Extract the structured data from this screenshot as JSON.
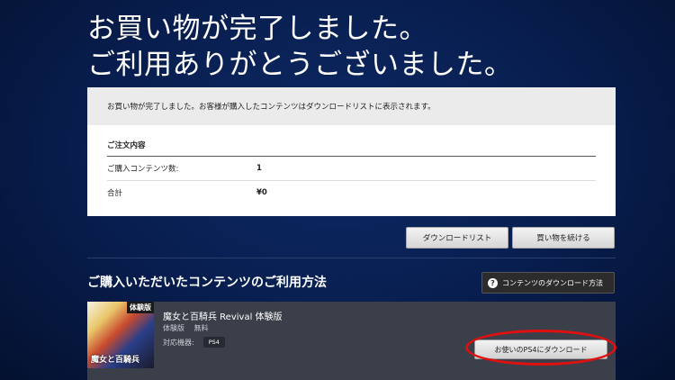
{
  "headline": {
    "line1": "お買い物が完了しました。",
    "line2": "ご利用ありがとうございました。"
  },
  "panel": {
    "message": "お買い物が完了しました。お客様が購入したコンテンツはダウンロードリストに表示されます。",
    "order_title": "ご注文内容",
    "rows": [
      {
        "label": "ご購入コンテンツ数:",
        "value": "1"
      },
      {
        "label": "合計",
        "value": "¥0"
      }
    ]
  },
  "buttons": {
    "download_list": "ダウンロードリスト",
    "continue_shopping": "買い物を続ける",
    "how_to_download": "コンテンツのダウンロード方法"
  },
  "section": {
    "title": "ご購入いただいたコンテンツのご利用方法"
  },
  "product": {
    "title": "魔女と百騎兵 Revival 体験版",
    "type": "体験版",
    "price": "無料",
    "device_label": "対応機器:",
    "device": "PS4",
    "download_button": "お使いのPS4にダウンロード",
    "thumb_badge": "体験版",
    "thumb_logo": "魔女と百騎兵"
  },
  "colors": {
    "background": "#081d4d",
    "highlight": "#e01010"
  }
}
